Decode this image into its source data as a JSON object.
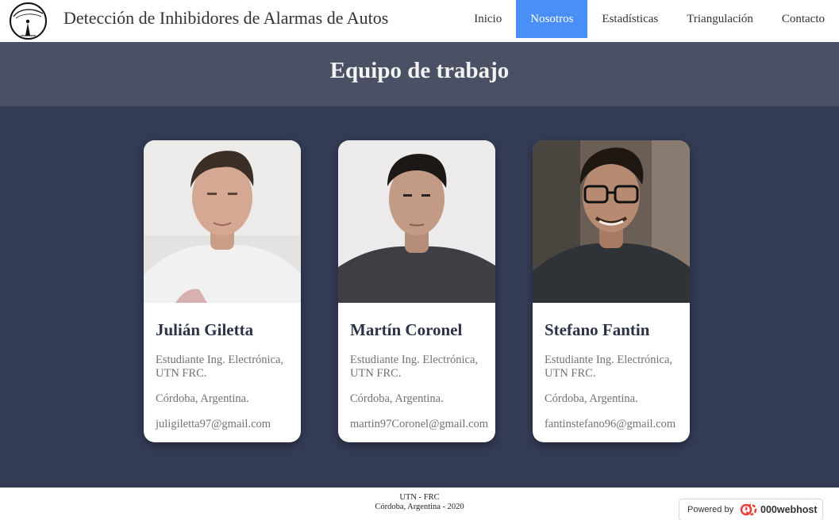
{
  "header": {
    "logo_icon": "site-logo-icon",
    "title": "Detección de Inhibidores de Alarmas de Autos",
    "nav": [
      {
        "label": "Inicio",
        "active": false
      },
      {
        "label": "Nosotros",
        "active": true
      },
      {
        "label": "Estadísticas",
        "active": false
      },
      {
        "label": "Triangulación",
        "active": false
      },
      {
        "label": "Contacto",
        "active": false
      }
    ]
  },
  "banner": {
    "heading": "Equipo de trabajo"
  },
  "team": [
    {
      "name": "Julián Giletta",
      "role": "Estudiante Ing. Electrónica, UTN FRC.",
      "city": "Córdoba, Argentina.",
      "email": "juligiletta97@gmail.com"
    },
    {
      "name": "Martín Coronel",
      "role": "Estudiante Ing. Electrónica, UTN FRC.",
      "city": "Córdoba, Argentina.",
      "email": "martin97Coronel@gmail.com"
    },
    {
      "name": "Stefano Fantin",
      "role": "Estudiante Ing. Electrónica, UTN FRC.",
      "city": "Córdoba, Argentina.",
      "email": "fantinstefano96@gmail.com"
    }
  ],
  "footer": {
    "line1": "UTN - FRC",
    "line2": "Córdoba, Argentina - 2020",
    "powered_label": "Powered by",
    "powered_brand": "000webhost"
  },
  "colors": {
    "nav_active": "#4a8ff7",
    "banner_bg": "#4a5164",
    "main_bg": "#343b55",
    "name_color": "#2c3349"
  }
}
